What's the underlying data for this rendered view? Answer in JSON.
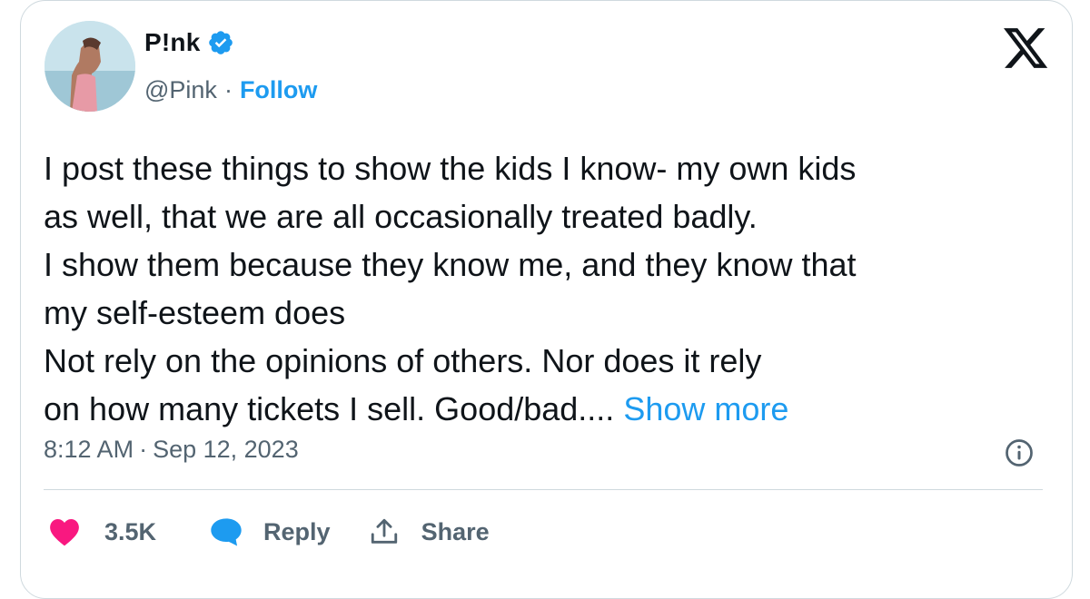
{
  "author": {
    "display_name": "P!nk",
    "handle": "@Pink",
    "separator": "·",
    "follow_label": "Follow",
    "verified": true
  },
  "tweet": {
    "body": "I post these things to show the kids I know- my own kids\nas well, that we are all occasionally treated badly.\nI show them because they know me, and they know that\nmy self-esteem does\nNot rely on the opinions of others. Nor does it rely\non how many tickets I sell. Good/bad.... ",
    "show_more_label": "Show more",
    "time": "8:12 AM",
    "separator": "·",
    "date": "Sep 12, 2023"
  },
  "actions": {
    "likes_count": "3.5K",
    "reply_label": "Reply",
    "share_label": "Share"
  },
  "icons": {
    "logo": "x-logo-icon",
    "verified": "verified-badge-icon",
    "info": "info-icon",
    "like": "heart-icon",
    "reply": "speech-bubble-icon",
    "share": "share-arrow-icon"
  },
  "colors": {
    "link_blue": "#1d9bf0",
    "like_pink": "#f91880",
    "text": "#0f1419",
    "secondary_text": "#536471",
    "border": "#cfd9de"
  }
}
